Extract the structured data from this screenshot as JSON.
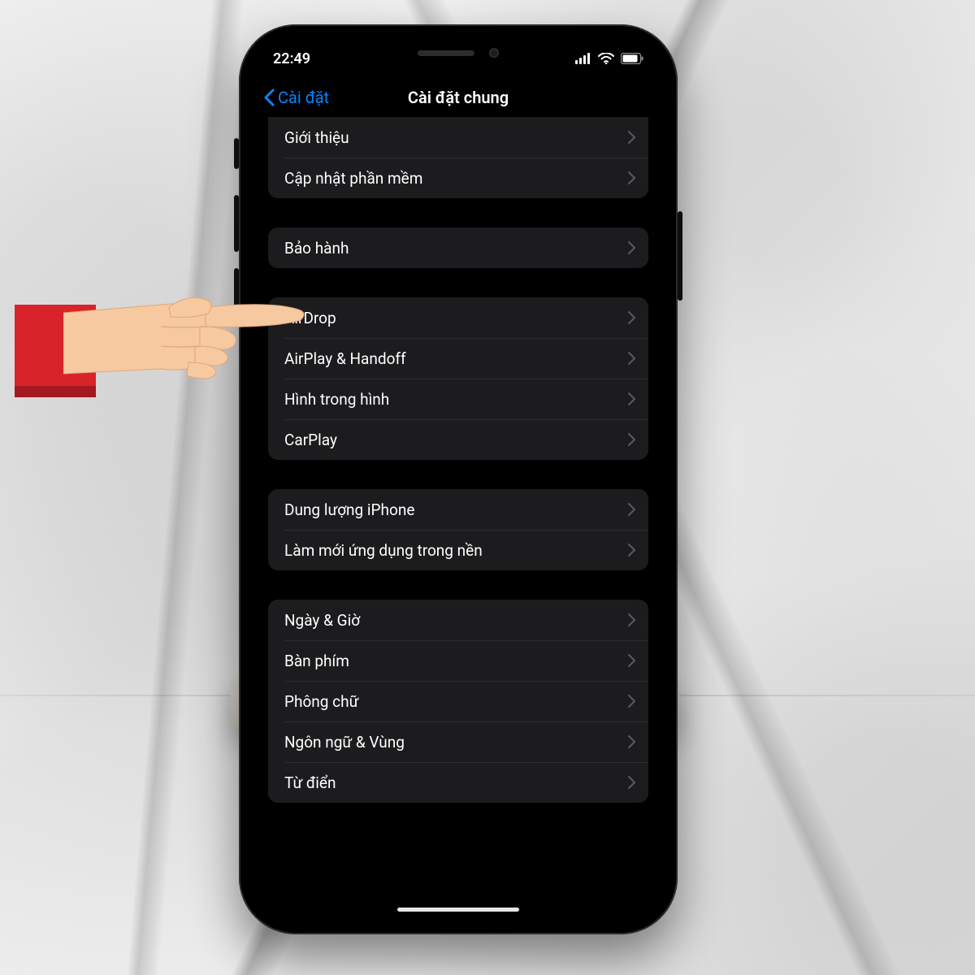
{
  "statusbar": {
    "time": "22:49"
  },
  "nav": {
    "back_label": "Cài đặt",
    "title": "Cài đặt chung"
  },
  "groups": [
    {
      "rows": [
        "Giới thiệu",
        "Cập nhật phần mềm"
      ]
    },
    {
      "rows": [
        "Bảo hành"
      ]
    },
    {
      "rows": [
        "AirDrop",
        "AirPlay & Handoff",
        "Hình trong hình",
        "CarPlay"
      ]
    },
    {
      "rows": [
        "Dung lượng iPhone",
        "Làm mới ứng dụng trong nền"
      ]
    },
    {
      "rows": [
        "Ngày & Giờ",
        "Bàn phím",
        "Phông chữ",
        "Ngôn ngữ & Vùng",
        "Từ điển"
      ]
    }
  ],
  "pointer_target_row": "AirDrop",
  "colors": {
    "accent_blue": "#0a84ff",
    "cuff_red": "#d8232a",
    "skin": "#f6c9a0"
  }
}
